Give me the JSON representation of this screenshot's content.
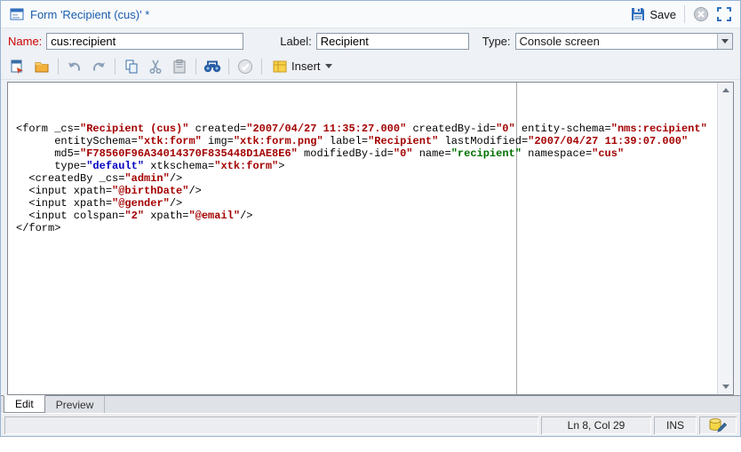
{
  "window": {
    "title": "Form 'Recipient (cus)' *"
  },
  "header": {
    "save_label": "Save"
  },
  "fields": {
    "name_label": "Name:",
    "name_value": "cus:recipient",
    "label_label": "Label:",
    "label_value": "Recipient",
    "type_label": "Type:",
    "type_value": "Console screen"
  },
  "toolbar": {
    "insert_label": "Insert"
  },
  "editor": {
    "lines": [
      [
        [
          "p",
          "<form _cs="
        ],
        [
          "v",
          "\"Recipient (cus)\""
        ],
        [
          "p",
          " created="
        ],
        [
          "v",
          "\"2007/04/27 11:35:27.000\""
        ],
        [
          "p",
          " createdBy-id="
        ],
        [
          "v",
          "\"0\""
        ],
        [
          "p",
          " entity-schema="
        ],
        [
          "v",
          "\"nms:recipient\""
        ]
      ],
      [
        [
          "p",
          "      entitySchema="
        ],
        [
          "v",
          "\"xtk:form\""
        ],
        [
          "p",
          " img="
        ],
        [
          "v",
          "\"xtk:form.png\""
        ],
        [
          "p",
          " label="
        ],
        [
          "v",
          "\"Recipient\""
        ],
        [
          "p",
          " lastModified="
        ],
        [
          "v",
          "\"2007/04/27 11:39:07.000\""
        ]
      ],
      [
        [
          "p",
          "      md5="
        ],
        [
          "v",
          "\"F78560F96A34014370F835448D1AE8E6\""
        ],
        [
          "p",
          " modifiedBy-id="
        ],
        [
          "v",
          "\"0\""
        ],
        [
          "p",
          " name="
        ],
        [
          "g",
          "\"recipient\""
        ],
        [
          "p",
          " namespace="
        ],
        [
          "v",
          "\"cus\""
        ]
      ],
      [
        [
          "p",
          "      type="
        ],
        [
          "b",
          "\"default\""
        ],
        [
          "p",
          " xtkschema="
        ],
        [
          "v",
          "\"xtk:form\""
        ],
        [
          "p",
          ">"
        ]
      ],
      [
        [
          "p",
          "  <createdBy _cs="
        ],
        [
          "v",
          "\"admin\""
        ],
        [
          "p",
          "/>"
        ]
      ],
      [
        [
          "p",
          "  <input xpath="
        ],
        [
          "v",
          "\"@birthDate\""
        ],
        [
          "p",
          "/>"
        ]
      ],
      [
        [
          "p",
          "  <input xpath="
        ],
        [
          "v",
          "\"@gender\""
        ],
        [
          "p",
          "/>"
        ]
      ],
      [
        [
          "p",
          "  <input colspan="
        ],
        [
          "v",
          "\"2\""
        ],
        [
          "p",
          " xpath="
        ],
        [
          "v",
          "\"@email\""
        ],
        [
          "p",
          "/>"
        ]
      ],
      [
        [
          "p",
          "</form>"
        ]
      ]
    ]
  },
  "tabs": {
    "edit": "Edit",
    "preview": "Preview"
  },
  "statusbar": {
    "line_col": "Ln 8, Col 29",
    "mode": "INS"
  },
  "colors": {
    "title_color": "#1a5dab",
    "name_label_color": "#cc0000",
    "value_color": "#a40000",
    "name_value_color": "#007000",
    "type_value_color": "#0000c0",
    "accent_blue": "#2f6fbe"
  }
}
